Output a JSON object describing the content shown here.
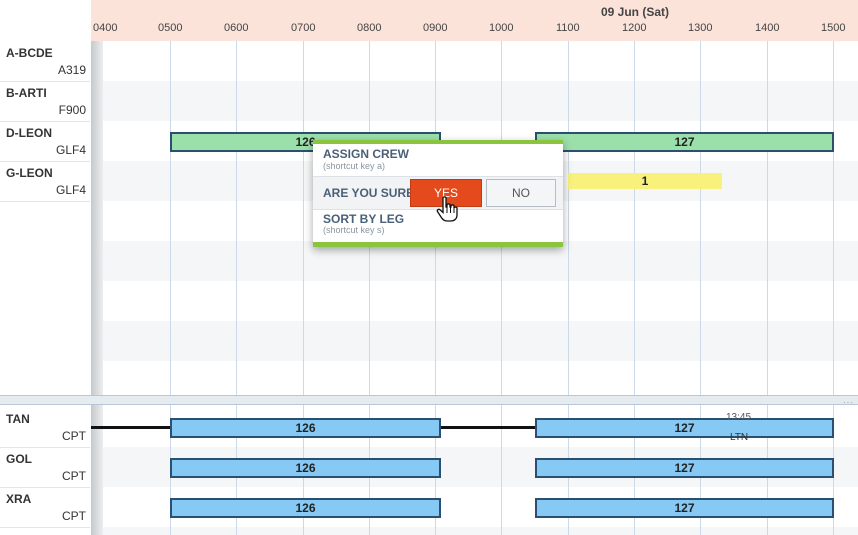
{
  "timeline": {
    "date_label": "09 Jun (Sat)",
    "hours": [
      "0400",
      "0500",
      "0600",
      "0700",
      "0800",
      "0900",
      "1000",
      "1100",
      "1200",
      "1300",
      "1400",
      "1500"
    ]
  },
  "aircraft_rows": [
    {
      "reg": "A-BCDE",
      "type": "A319"
    },
    {
      "reg": "B-ARTI",
      "type": "F900"
    },
    {
      "reg": "D-LEON",
      "type": "GLF4"
    },
    {
      "reg": "G-LEON",
      "type": "GLF4"
    }
  ],
  "aircraft_bars": {
    "dleon_126": "126",
    "dleon_127": "127",
    "gleon_1": "1"
  },
  "popup": {
    "assign_title": "ASSIGN CREW",
    "assign_sub": "(shortcut key a)",
    "confirm_label": "ARE YOU SURE?",
    "yes_label": "YES",
    "no_label": "NO",
    "sort_title": "SORT BY LEG",
    "sort_sub": "(shortcut key s)"
  },
  "crew_rows": [
    {
      "code": "TAN",
      "base": "CPT",
      "legs": [
        "126",
        "127"
      ]
    },
    {
      "code": "GOL",
      "base": "CPT",
      "legs": [
        "126",
        "127"
      ]
    },
    {
      "code": "XRA",
      "base": "CPT",
      "legs": [
        "126",
        "127"
      ]
    }
  ],
  "crew_annotation": {
    "time": "13:45",
    "airport": "LTN"
  },
  "colors": {
    "header": "#fbe3da",
    "green_bar": "#9bdfaa",
    "blue_bar": "#86c9f5",
    "yellow_bar": "#f8f17c",
    "yes_button": "#e44a1c",
    "popup_border": "#8bc53f"
  }
}
